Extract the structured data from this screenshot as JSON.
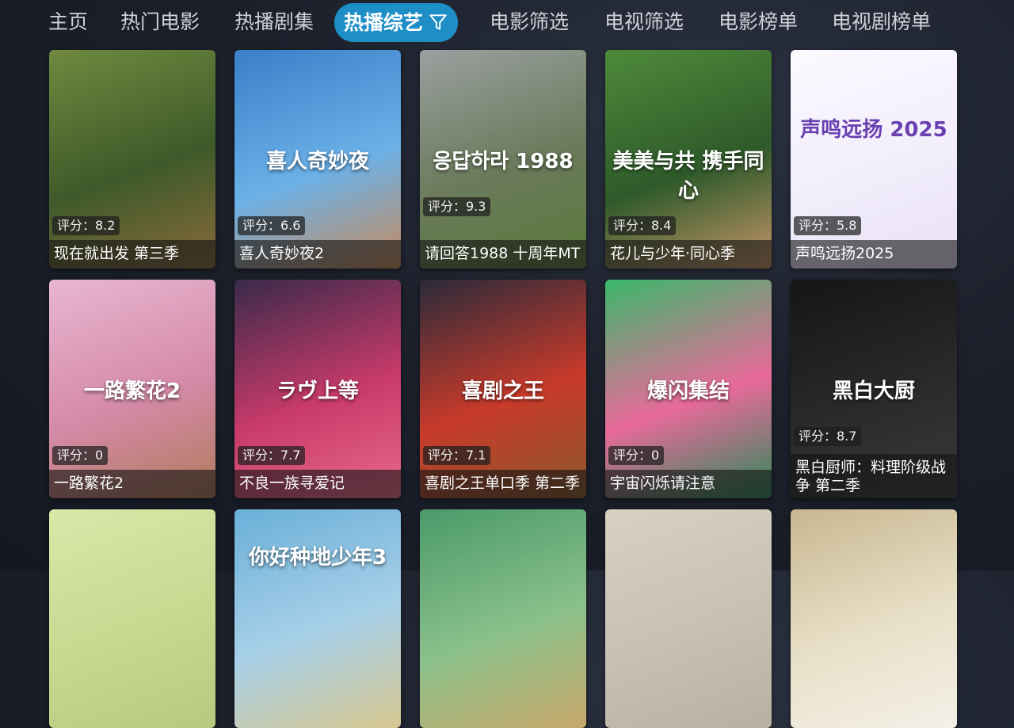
{
  "nav": {
    "items": [
      "主页",
      "热门电影",
      "热播剧集",
      "热播综艺",
      "电影筛选",
      "电视筛选",
      "电影榜单",
      "电视剧榜单"
    ],
    "active_index": 3,
    "active_color": "#1e8fc6",
    "filter_icon": "filter-icon"
  },
  "cards": [
    {
      "title": "现在就出发 第三季",
      "rating": "评分：8.2",
      "colors": [
        "#6f8a3e",
        "#3e5a2a",
        "#8a6a3c"
      ]
    },
    {
      "title": "喜人奇妙夜2",
      "rating": "评分：6.6",
      "colors": [
        "#3a7fc8",
        "#6bb1e8",
        "#c88a5a"
      ],
      "poster_text": "喜人奇妙夜"
    },
    {
      "title": "请回答1988 十周年MT",
      "rating": "评分：9.3",
      "colors": [
        "#9aa0a0",
        "#6a7a5a",
        "#5a7a3a"
      ],
      "poster_text": "응답하라 1988"
    },
    {
      "title": "花儿与少年·同心季",
      "rating": "评分：8.4",
      "colors": [
        "#4e8a3a",
        "#2e5a2a",
        "#c8966a"
      ],
      "poster_text": "美美与共 携手同心"
    },
    {
      "title": "声鸣远扬2025",
      "rating": "评分：5.8",
      "colors": [
        "#fbfaff",
        "#f2eefb",
        "#e8e0f6"
      ],
      "poster_text": "声鸣远扬 2025",
      "light": true
    },
    {
      "title": "一路繁花2",
      "rating": "评分：0",
      "colors": [
        "#e8b6d0",
        "#d48aa8",
        "#b07a5a"
      ],
      "poster_text": "一路繁花2"
    },
    {
      "title": "不良一族寻爱记",
      "rating": "评分：7.7",
      "colors": [
        "#3a2a4a",
        "#c83a6a",
        "#e86a8a"
      ],
      "poster_text": "ラヴ上等"
    },
    {
      "title": "喜剧之王单口季 第二季",
      "rating": "评分：7.1",
      "colors": [
        "#2a2a3a",
        "#c83a2a",
        "#8a5a2a"
      ],
      "poster_text": "喜剧之王"
    },
    {
      "title": "宇宙闪烁请注意",
      "rating": "评分：0",
      "colors": [
        "#3ab86a",
        "#e86a9a",
        "#2a8a5a"
      ],
      "poster_text": "爆闪集结"
    },
    {
      "title": "黑白厨师：料理阶级战争 第二季",
      "rating": "评分：8.7",
      "colors": [
        "#151515",
        "#2a2a2a",
        "#3a3a3a"
      ],
      "poster_text": "黑白大厨"
    },
    {
      "title": "",
      "rating": "",
      "colors": [
        "#d8e8a8",
        "#c8d890",
        "#b8c880"
      ]
    },
    {
      "title": "",
      "rating": "",
      "colors": [
        "#6ab0d8",
        "#a8d0e8",
        "#d8c890"
      ],
      "poster_text": "你好种地少年3"
    },
    {
      "title": "",
      "rating": "",
      "colors": [
        "#4a9a6a",
        "#8ac08a",
        "#c8a86a"
      ]
    },
    {
      "title": "",
      "rating": "",
      "colors": [
        "#d8d0c0",
        "#c8c0b0",
        "#b8b0a0"
      ]
    },
    {
      "title": "",
      "rating": "",
      "colors": [
        "#c8b890",
        "#e8e0c8",
        "#f4f0e8"
      ]
    }
  ]
}
